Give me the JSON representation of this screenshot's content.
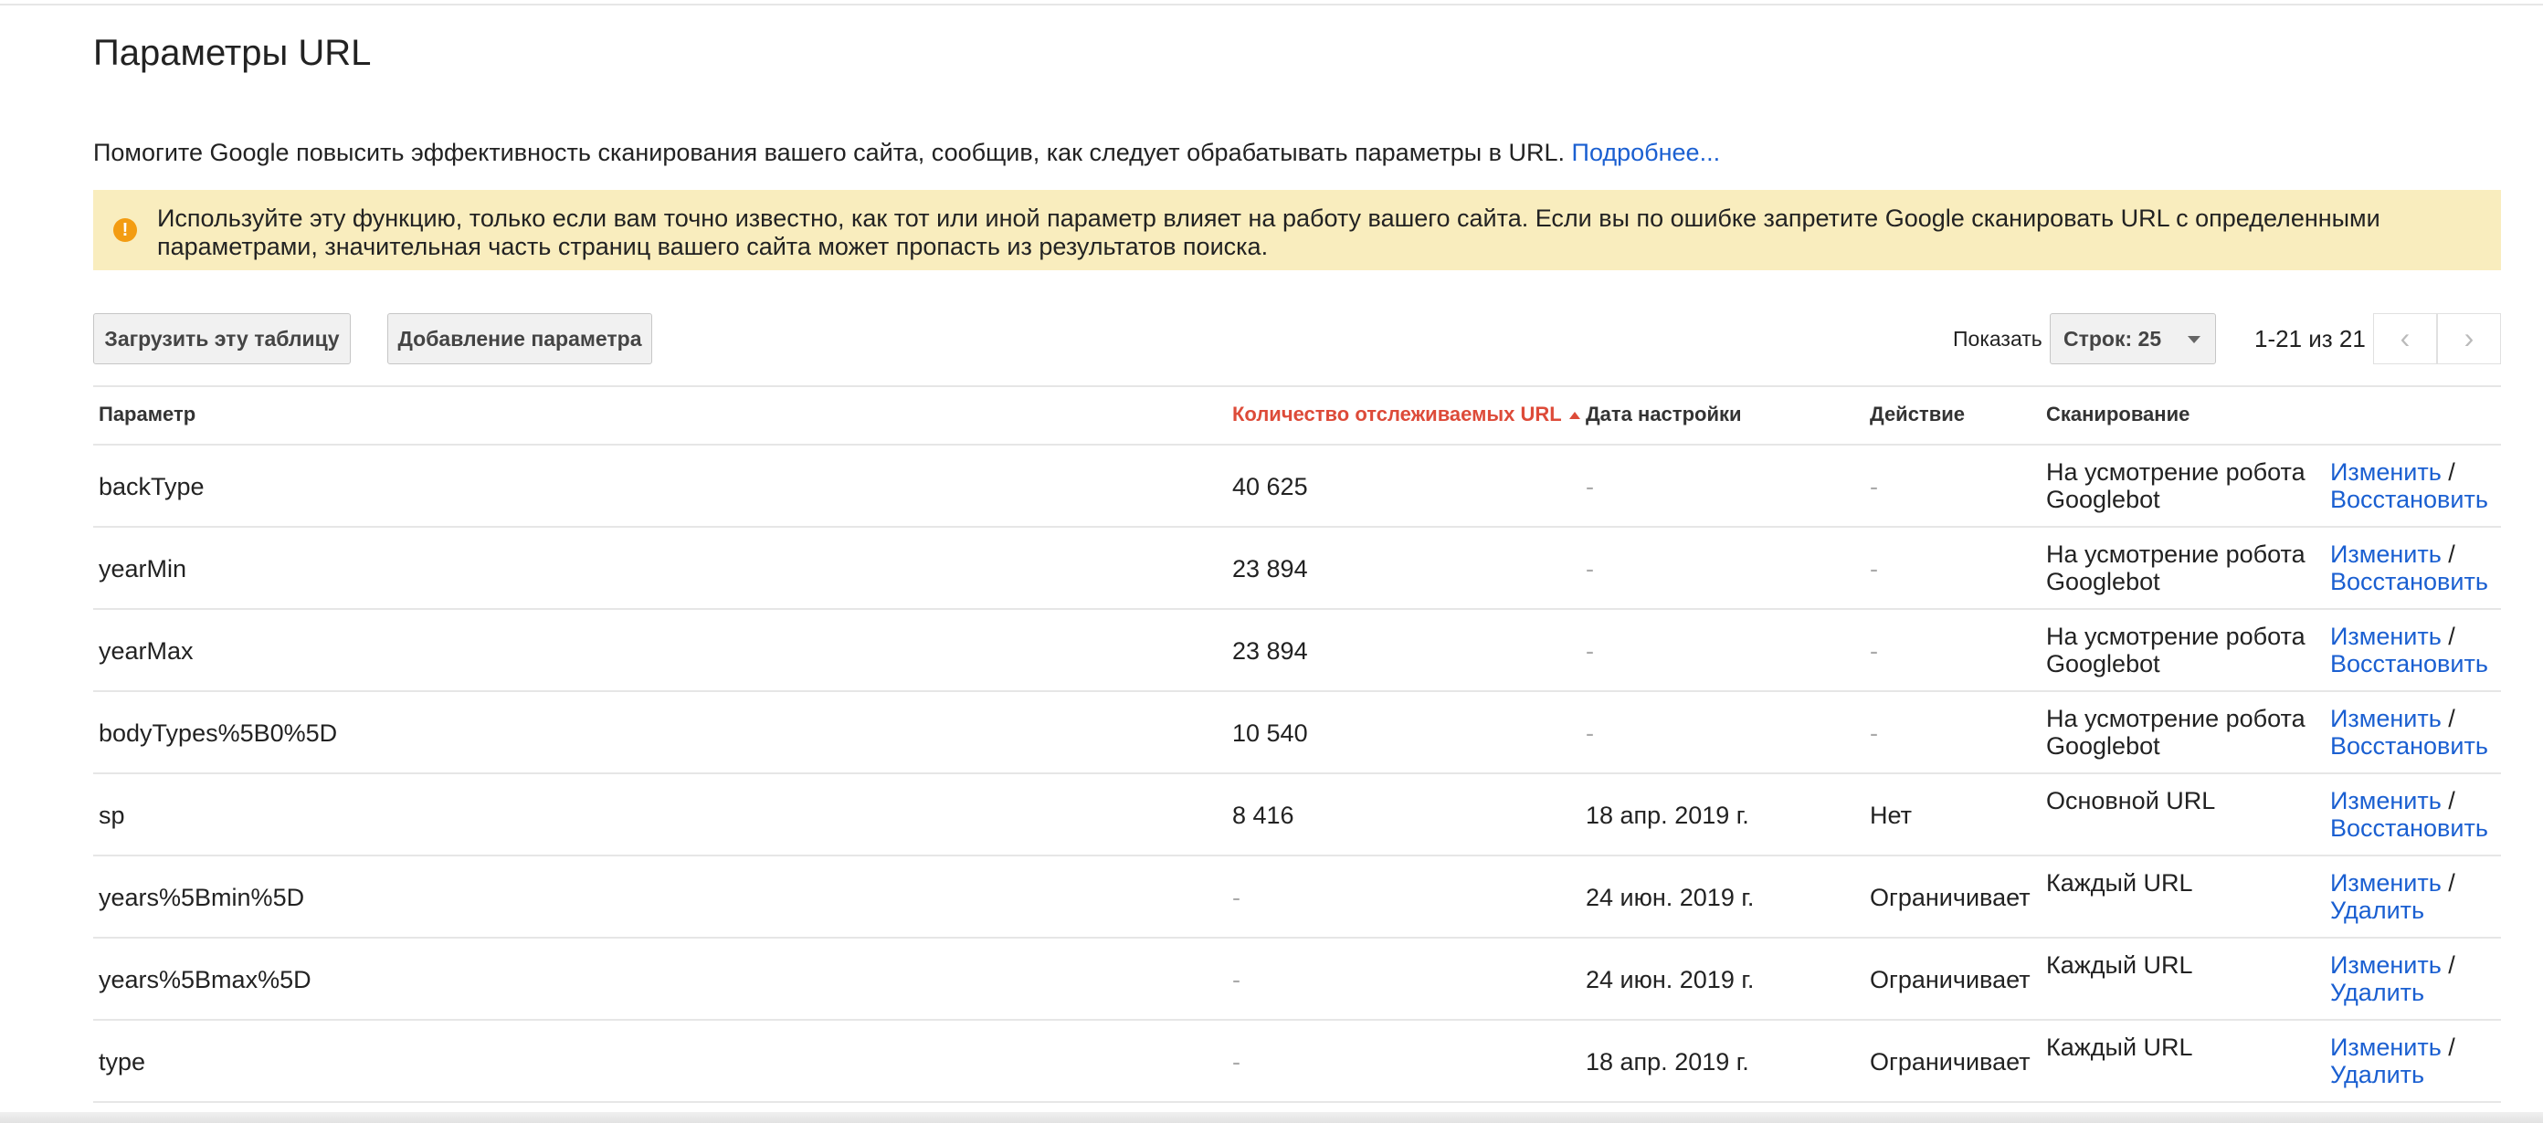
{
  "page": {
    "title": "Параметры URL",
    "intro_text": "Помогите Google повысить эффективность сканирования вашего сайта, сообщив, как следует обрабатывать параметры в URL.",
    "intro_link": "Подробнее..."
  },
  "warning": {
    "icon": "exclamation-icon",
    "icon_glyph": "!",
    "text": "Используйте эту функцию, только если вам точно известно, как тот или иной параметр влияет на работу вашего сайта. Если вы по ошибке запретите Google сканировать URL с определенными параметрами, значительная часть страниц вашего сайта может пропасть из результатов поиска.",
    "background": "#f9edbe",
    "icon_color": "#f39c12"
  },
  "toolbar": {
    "download_label": "Загрузить эту таблицу",
    "add_label": "Добавление параметра",
    "show_label": "Показать",
    "rows_select_value": "Строк: 25",
    "range_text": "1-21 из 21",
    "prev_icon": "chevron-left-icon",
    "prev_glyph": "‹",
    "next_icon": "chevron-right-icon",
    "next_glyph": "›"
  },
  "table": {
    "headers": {
      "param": "Параметр",
      "count": "Количество отслеживаемых URL",
      "date": "Дата настройки",
      "action": "Действие",
      "crawl": "Сканирование"
    },
    "sort_color": "#dd4b39",
    "link_color": "#1a5fd1",
    "rows": [
      {
        "param": "backType",
        "count": "40 625",
        "date": "-",
        "action": "-",
        "crawl": "На усмотрение робота Googlebot",
        "link1": "Изменить",
        "sep": " /",
        "link2": "Восстановить"
      },
      {
        "param": "yearMin",
        "count": "23 894",
        "date": "-",
        "action": "-",
        "crawl": "На усмотрение робота Googlebot",
        "link1": "Изменить",
        "sep": " /",
        "link2": "Восстановить"
      },
      {
        "param": "yearMax",
        "count": "23 894",
        "date": "-",
        "action": "-",
        "crawl": "На усмотрение робота Googlebot",
        "link1": "Изменить",
        "sep": " /",
        "link2": "Восстановить"
      },
      {
        "param": "bodyTypes%5B0%5D",
        "count": "10 540",
        "date": "-",
        "action": "-",
        "crawl": "На усмотрение робота Googlebot",
        "link1": "Изменить",
        "sep": " /",
        "link2": "Восстановить"
      },
      {
        "param": "sp",
        "count": "8 416",
        "date": "18 апр. 2019 г.",
        "action": "Нет",
        "crawl": "Основной URL",
        "link1": "Изменить",
        "sep": " /",
        "link2": "Восстановить"
      },
      {
        "param": "years%5Bmin%5D",
        "count": "-",
        "date": "24 июн. 2019 г.",
        "action": "Ограничивает",
        "crawl": "Каждый URL",
        "link1": "Изменить",
        "sep": " /",
        "link2": "Удалить"
      },
      {
        "param": "years%5Bmax%5D",
        "count": "-",
        "date": "24 июн. 2019 г.",
        "action": "Ограничивает",
        "crawl": "Каждый URL",
        "link1": "Изменить",
        "sep": " /",
        "link2": "Удалить"
      },
      {
        "param": "type",
        "count": "-",
        "date": "18 апр. 2019 г.",
        "action": "Ограничивает",
        "crawl": "Каждый URL",
        "link1": "Изменить",
        "sep": " /",
        "link2": "Удалить"
      }
    ]
  }
}
